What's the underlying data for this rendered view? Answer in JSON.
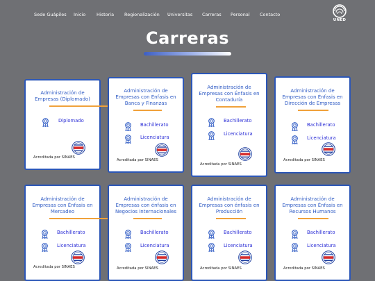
{
  "nav": {
    "items": [
      "Sede Guápiles",
      "Inicio",
      "Historia",
      "Regionalización",
      "Universitas",
      "Carreras",
      "Personal",
      "Contacto"
    ],
    "logo_text": "UNED"
  },
  "page": {
    "title": "Carreras"
  },
  "accreditation_text": "Acreditada por SINAES",
  "cards": [
    {
      "title": "Administración de Empresas (Diplomado)",
      "degrees": [
        "Diplomado"
      ]
    },
    {
      "title": "Administración de Empresas con Énfasis en Banca y Finanzas",
      "degrees": [
        "Bachillerato",
        "Licenciatura"
      ]
    },
    {
      "title": "Administración de Empresas con Énfasis en Contaduría",
      "degrees": [
        "Bachillerato",
        "Licenciatura"
      ]
    },
    {
      "title": "Administración de Empresas con Énfasis en Dirección de Empresas",
      "degrees": [
        "Bachillerato",
        "Licenciatura"
      ]
    },
    {
      "title": "Administración de Empresas con Énfasis en Mercadeo",
      "degrees": [
        "Bachillerato",
        "Licenciatura"
      ]
    },
    {
      "title": "Administración de Empresas con énfasis en Negocios Internacionales",
      "degrees": [
        "Bachillerato",
        "Licenciatura"
      ]
    },
    {
      "title": "Administración de Empresas con énfasis en Producción",
      "degrees": [
        "Bachillerato",
        "Licenciatura"
      ]
    },
    {
      "title": "Administración de Empresas con Énfasis en Recursos Humanos",
      "degrees": [
        "Bachillerato",
        "Licenciatura"
      ]
    }
  ],
  "colors": {
    "background": "#6f7074",
    "card_border": "#2b56b7",
    "title_blue": "#2f5bc4",
    "accent_orange": "#f0a13a",
    "degree_link": "#2c2fd6"
  },
  "icons": {
    "degree": "award-ribbon-icon",
    "seal": "sinaes-seal-icon"
  }
}
